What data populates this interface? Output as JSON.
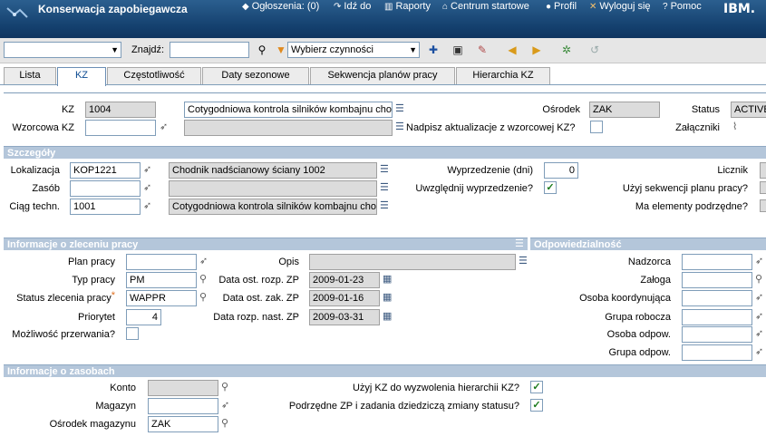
{
  "header": {
    "app_title": "Konserwacja zapobiegawcza",
    "nav": {
      "announcements": "Ogłoszenia: (0)",
      "goto": "Idź do",
      "reports": "Raporty",
      "start_center": "Centrum startowe",
      "profile": "Profil",
      "logout": "Wyloguj się",
      "help": "Pomoc"
    },
    "brand": "IBM."
  },
  "toolbar": {
    "find_label": "Znajdź:",
    "actions_select": "Wybierz czynności"
  },
  "tabs": [
    "Lista",
    "KZ",
    "Częstotliwość",
    "Daty sezonowe",
    "Sekwencja planów pracy",
    "Hierarchia KZ"
  ],
  "main": {
    "kz_label": "KZ",
    "kz_value": "1004",
    "kz_desc": "Cotygodniowa kontrola silników kombajnu chod",
    "template_label": "Wzorcowa KZ",
    "overwrite_label": "Nadpisz aktualizacje z wzorcowej KZ?",
    "site_label": "Ośrodek",
    "site_value": "ZAK",
    "status_label": "Status",
    "status_value": "ACTIVE",
    "attachments_label": "Załączniki"
  },
  "details": {
    "title": "Szczegóły",
    "location_label": "Lokalizacja",
    "location_value": "KOP1221",
    "location_desc": "Chodnik nadścianowy ściany 1002",
    "asset_label": "Zasób",
    "route_label": "Ciąg techn.",
    "route_value": "1001",
    "route_desc": "Cotygodniowa kontrola silników kombajnu choc",
    "lead_label": "Wyprzedzenie (dni)",
    "lead_value": "0",
    "use_lead_label": "Uwzględnij wyprzedzenie?",
    "use_lead_checked": true,
    "meter_label": "Licznik",
    "use_seq_label": "Użyj sekwencji planu pracy?",
    "has_children_label": "Ma elementy podrzędne?"
  },
  "work_order": {
    "title": "Informacje o zleceniu pracy",
    "job_plan_label": "Plan pracy",
    "desc_label": "Opis",
    "work_type_label": "Typ pracy",
    "work_type_value": "PM",
    "last_start_label": "Data ost. rozp. ZP",
    "last_start_value": "2009-01-23",
    "status_label": "Status zlecenia pracy",
    "status_value": "WAPPR",
    "last_end_label": "Data ost. zak. ZP",
    "last_end_value": "2009-01-16",
    "priority_label": "Priorytet",
    "priority_value": "4",
    "next_start_label": "Data rozp. nast. ZP",
    "next_start_value": "2009-03-31",
    "interruptible_label": "Możliwość przerwania?"
  },
  "responsibility": {
    "title": "Odpowiedzialność",
    "supervisor": "Nadzorca",
    "crew": "Załoga",
    "lead": "Osoba koordynująca",
    "labor_group": "Grupa robocza",
    "owner": "Osoba odpow.",
    "owner_group": "Grupa odpow."
  },
  "assets_info": {
    "title": "Informacje o zasobach",
    "account_label": "Konto",
    "storeroom_label": "Magazyn",
    "storeroom_site_label": "Ośrodek magazynu",
    "storeroom_site_value": "ZAK",
    "use_hierarchy_label": "Użyj KZ do wyzwolenia hierarchii KZ?",
    "use_hierarchy_checked": true,
    "children_inherit_label": "Podrzędne ZP i zadania dziedziczą zmiany statusu?",
    "children_inherit_checked": true
  }
}
